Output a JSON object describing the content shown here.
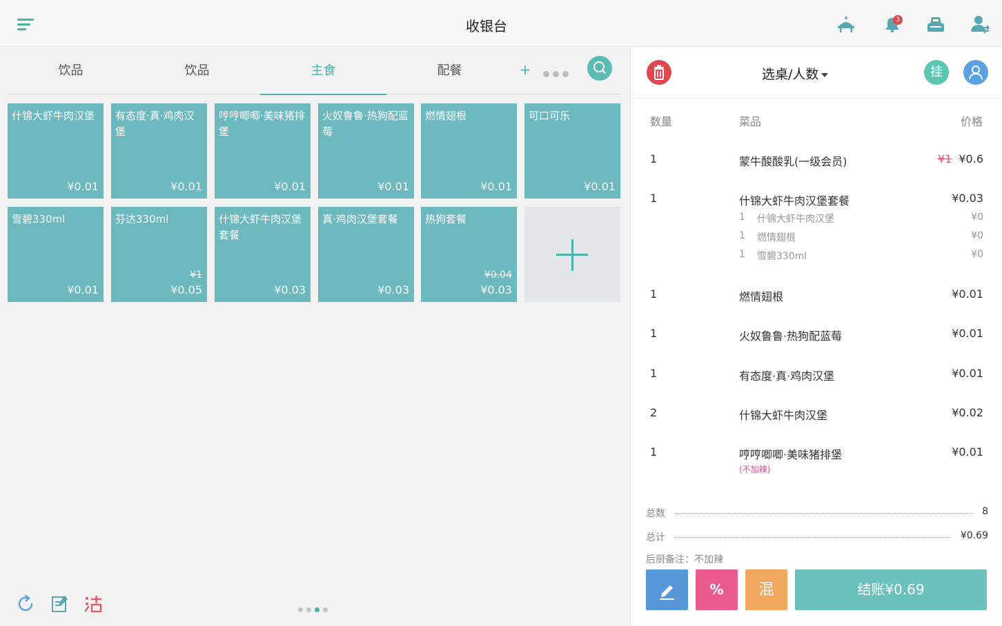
{
  "header": {
    "title": "收银台"
  },
  "tabs": [
    {
      "label": "饮品",
      "active": false
    },
    {
      "label": "饮品",
      "active": false
    },
    {
      "label": "主食",
      "active": true
    },
    {
      "label": "配餐",
      "active": false
    }
  ],
  "tab_add_label": "+",
  "products": [
    {
      "name": "什锦大虾牛肉汉堡",
      "price": "¥0.01",
      "old_price": ""
    },
    {
      "name": "有态度·真·鸡肉汉堡",
      "price": "¥0.01",
      "old_price": ""
    },
    {
      "name": "哼哼唧唧·美味猪排堡",
      "price": "¥0.01",
      "old_price": ""
    },
    {
      "name": "火奴鲁鲁·热狗配蓝莓",
      "price": "¥0.01",
      "old_price": ""
    },
    {
      "name": "燃情翅根",
      "price": "¥0.01",
      "old_price": ""
    },
    {
      "name": "可口可乐",
      "price": "¥0.01",
      "old_price": ""
    },
    {
      "name": "雪碧330ml",
      "price": "¥0.01",
      "old_price": ""
    },
    {
      "name": "芬达330ml",
      "price": "¥0.05",
      "old_price": "¥1"
    },
    {
      "name": "什锦大虾牛肉汉堡套餐",
      "price": "¥0.03",
      "old_price": ""
    },
    {
      "name": "真·鸡肉汉堡套餐",
      "price": "¥0.03",
      "old_price": ""
    },
    {
      "name": "热狗套餐",
      "price": "¥0.03",
      "old_price": "¥0.04"
    }
  ],
  "order_header": {
    "table_select": "选桌/人数",
    "hang_label": "挂"
  },
  "columns": {
    "qty": "数量",
    "dish": "菜品",
    "price": "价格"
  },
  "order_items": [
    {
      "qty": "1",
      "name": "蒙牛酸酸乳(一级会员)",
      "old_price": "¥1",
      "price": "¥0.6",
      "note": "",
      "subitems": []
    },
    {
      "qty": "1",
      "name": "什锦大虾牛肉汉堡套餐",
      "old_price": "",
      "price": "¥0.03",
      "note": "",
      "subitems": [
        {
          "qty": "1",
          "name": "什锦大虾牛肉汉堡",
          "price": "¥0"
        },
        {
          "qty": "1",
          "name": "燃情翅根",
          "price": "¥0"
        },
        {
          "qty": "1",
          "name": "雪碧330ml",
          "price": "¥0"
        }
      ]
    },
    {
      "qty": "1",
      "name": "燃情翅根",
      "old_price": "",
      "price": "¥0.01",
      "note": "",
      "subitems": []
    },
    {
      "qty": "1",
      "name": "火奴鲁鲁·热狗配蓝莓",
      "old_price": "",
      "price": "¥0.01",
      "note": "",
      "subitems": []
    },
    {
      "qty": "1",
      "name": "有态度·真·鸡肉汉堡",
      "old_price": "",
      "price": "¥0.01",
      "note": "",
      "subitems": []
    },
    {
      "qty": "2",
      "name": "什锦大虾牛肉汉堡",
      "old_price": "",
      "price": "¥0.02",
      "note": "",
      "subitems": []
    },
    {
      "qty": "1",
      "name": "哼哼唧唧·美味猪排堡",
      "old_price": "",
      "price": "¥0.01",
      "note": "(不加辣)",
      "subitems": []
    }
  ],
  "summary": {
    "count_label": "总数",
    "count_value": "8",
    "total_label": "总计",
    "total_value": "¥0.69",
    "kitchen_note": "后厨备注：不加辣"
  },
  "actions": {
    "discount_label": "%",
    "mix_label": "混",
    "pay_label": "结账¥0.69"
  },
  "notification_badge": "3",
  "colors": {
    "accent": "#47b3a9",
    "tile": "#6cb8bf",
    "danger": "#e0484f",
    "edit": "#5597d8",
    "discount": "#ec5b8f",
    "mix": "#f1a75e",
    "pay": "#6cc1bd"
  },
  "icons": [
    "menu-icon",
    "table-service-icon",
    "bell-icon",
    "cash-register-icon",
    "user-switch-icon",
    "search-icon",
    "trash-icon",
    "user-icon",
    "refresh-icon",
    "note-icon",
    "clear-icon",
    "pencil-icon",
    "plus-icon"
  ]
}
